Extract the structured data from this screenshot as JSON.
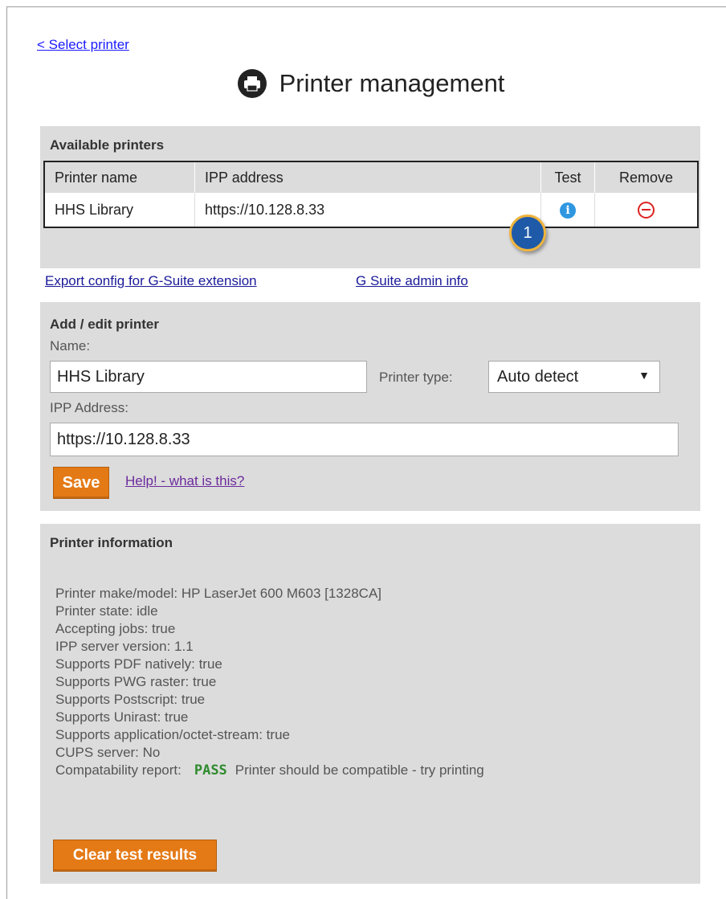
{
  "nav": {
    "back_label": "<  Select printer"
  },
  "header": {
    "title": "Printer management",
    "icon": "printer-icon"
  },
  "available": {
    "title": "Available printers",
    "columns": [
      "Printer name",
      "IPP address",
      "Test",
      "Remove"
    ],
    "rows": [
      {
        "name": "HHS Library",
        "address": "https://10.128.8.33"
      }
    ],
    "step_badge": "1"
  },
  "links": {
    "export": "Export config for G-Suite extension",
    "admin_info": "G Suite admin info"
  },
  "edit": {
    "title": "Add / edit printer",
    "name_label": "Name:",
    "name_value": "HHS Library",
    "type_label": "Printer type:",
    "type_value": "Auto detect",
    "ipp_label": "IPP Address:",
    "ipp_value": "https://10.128.8.33",
    "save_label": "Save",
    "help_label": "Help! - what is this?"
  },
  "info": {
    "title": "Printer information",
    "lines": [
      "Printer make/model: HP LaserJet 600 M603 [1328CA]",
      "Printer state: idle",
      "Accepting jobs: true",
      "IPP server version: 1.1",
      "Supports PDF natively: true",
      "Supports PWG raster: true",
      "Supports Postscript: true",
      "Supports Unirast: true",
      "Supports application/octet-stream: true",
      "CUPS server: No"
    ],
    "compat_label": "Compatability report:",
    "compat_status": "PASS",
    "compat_message": "Printer should be compatible - try printing",
    "clear_label": "Clear test results"
  },
  "colors": {
    "accent_button": "#e47a16",
    "pass": "#2e8b2e",
    "badge": "#1e5aa8",
    "badge_ring": "#f0b43c",
    "remove": "#dd2222",
    "info_icon": "#2f97e0"
  }
}
